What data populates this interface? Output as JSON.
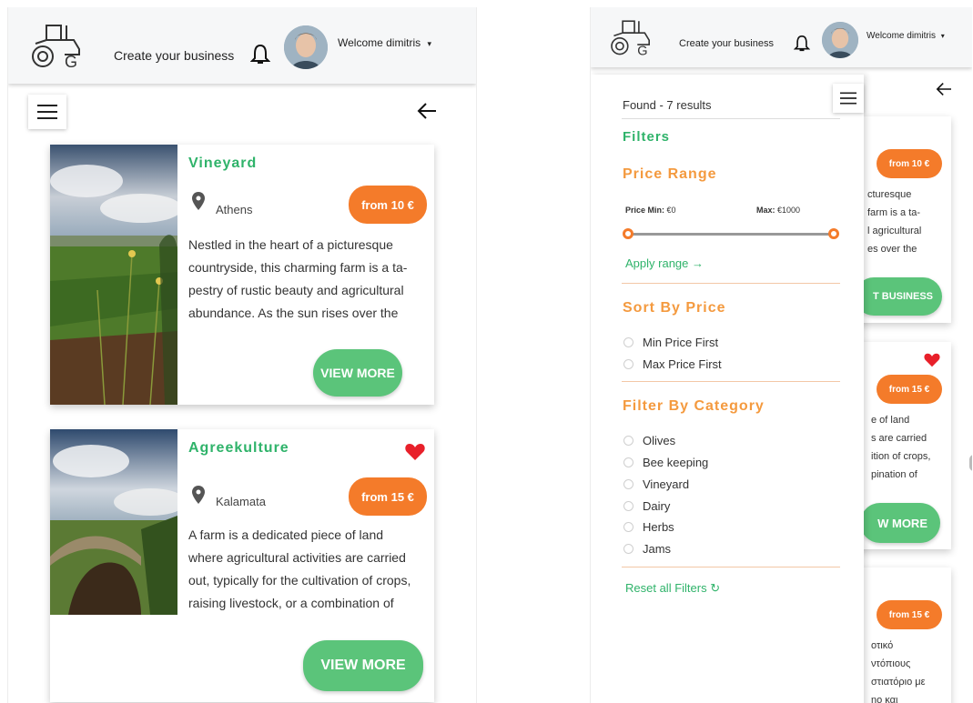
{
  "header": {
    "create_label": "Create your business",
    "welcome_label": "Welcome dimitris",
    "dropdown_caret": "▾"
  },
  "icons": {
    "logo": "tractor-logo-icon",
    "bell": "bell-icon",
    "menu": "hamburger-menu-icon",
    "back": "arrow-left-icon",
    "location": "map-pin-icon",
    "favorite": "heart-icon"
  },
  "colors": {
    "green": "#2fb36a",
    "button_green": "#5bc47a",
    "orange": "#f47b2a",
    "heart": "#e8202a"
  },
  "listings": [
    {
      "title": "Vineyard",
      "location": "Athens",
      "price": "from 10 €",
      "favorite": false,
      "description": "Nestled in the heart of a picturesque countryside, this charming farm is a tapestry of rustic beauty and agricultural abundance. As the sun rises over the",
      "desc_lines": [
        "Nestled in the heart of a picturesque",
        "countryside, this charming farm is a ta-",
        "pestry of rustic beauty and agricultural",
        "abundance. As the sun rises over the"
      ],
      "button": "VIEW MORE"
    },
    {
      "title": "Agreekulture",
      "location": "Kalamata",
      "price": "from 15 €",
      "favorite": true,
      "description": "A farm is a dedicated piece of land where agricultural activities are carried out, typically for the cultivation of crops, raising livestock, or a combination of",
      "desc_lines": [
        "A farm is a dedicated piece of land",
        "where agricultural activities are carried",
        "out, typically for the cultivation of crops,",
        "raising livestock, or a combination of"
      ],
      "button": "VIEW MORE"
    }
  ],
  "filters_panel": {
    "found": "Found - 7 results",
    "filters_title": "Filters",
    "price_range_title": "Price Range",
    "price_min_label": "Price Min:",
    "price_min_value": "€0",
    "price_max_label": "Max:",
    "price_max_value": "€1000",
    "apply_label": "Apply range →",
    "sort_title": "Sort By Price",
    "sort_options": [
      "Min Price First",
      "Max Price First"
    ],
    "category_title": "Filter By Category",
    "categories": [
      "Olives",
      "Bee keeping",
      "Vineyard",
      "Dairy",
      "Herbs",
      "Jams"
    ],
    "reset_label": "Reset all Filters ↻"
  },
  "background_cards": [
    {
      "price": "from 10 €",
      "text_lines": [
        "cturesque",
        "farm is a ta-",
        "l agricultural",
        "es over the"
      ],
      "button": "T BUSINESS",
      "favorite": false
    },
    {
      "price": "from 15 €",
      "text_lines": [
        "e of land",
        "s are carried",
        "ition of crops,",
        "pination of"
      ],
      "button": "W MORE",
      "favorite": true
    },
    {
      "price": "from 15 €",
      "text_lines": [
        "οτικό",
        "ντόπιους",
        "στιατόριο με",
        "ηο και"
      ],
      "button": "",
      "favorite": false
    }
  ]
}
